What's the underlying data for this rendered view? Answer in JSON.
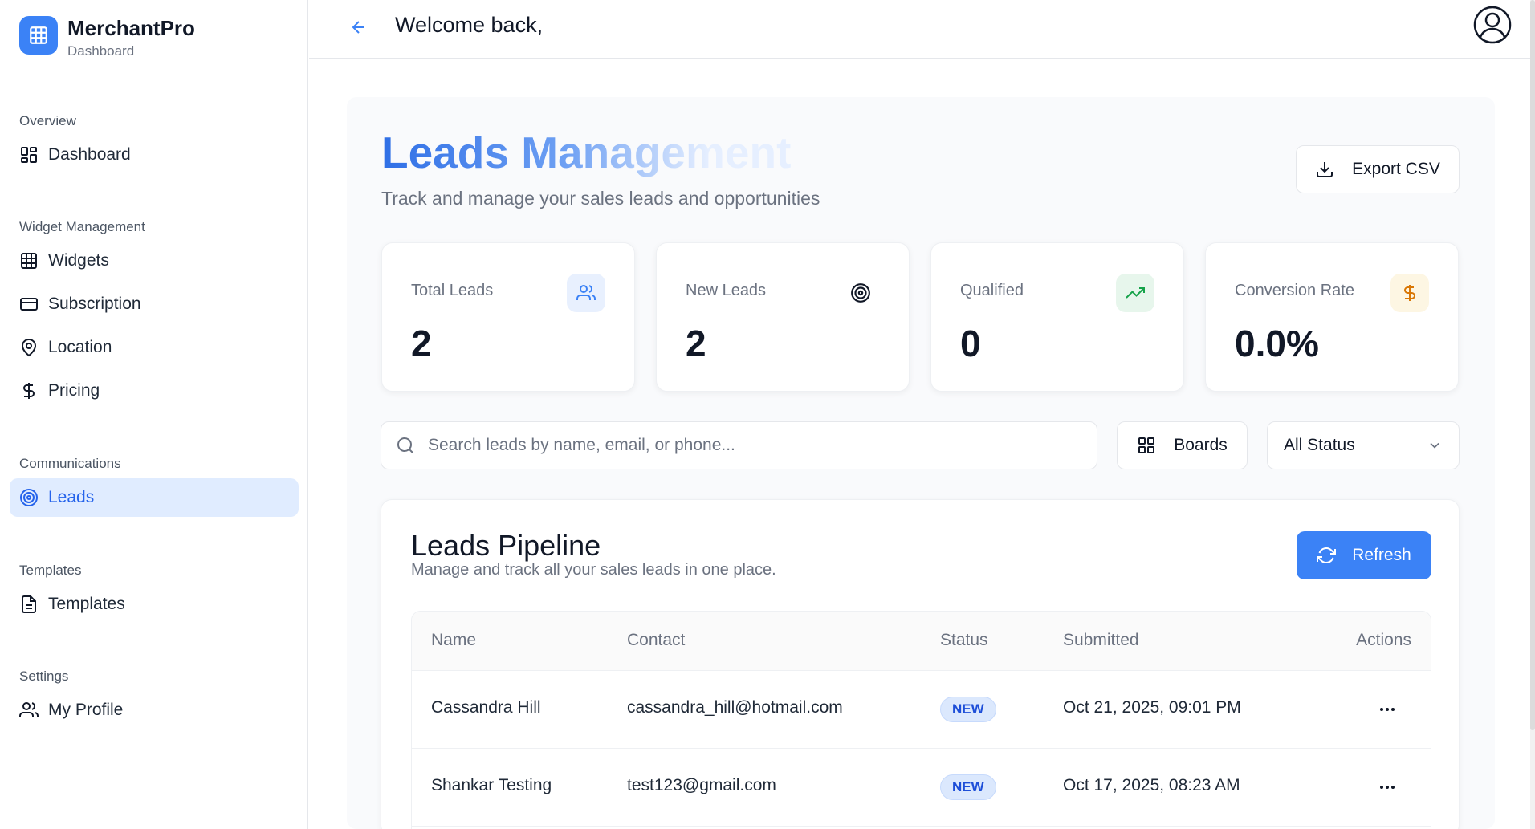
{
  "brand": {
    "name": "MerchantPro",
    "subtitle": "Dashboard"
  },
  "sidebar": {
    "sections": [
      {
        "heading": "Overview",
        "items": [
          {
            "label": "Dashboard",
            "icon": "dashboard-icon"
          }
        ]
      },
      {
        "heading": "Widget Management",
        "items": [
          {
            "label": "Widgets",
            "icon": "grid-icon"
          },
          {
            "label": "Subscription",
            "icon": "card-icon"
          },
          {
            "label": "Location",
            "icon": "map-pin-icon"
          },
          {
            "label": "Pricing",
            "icon": "dollar-icon"
          }
        ]
      },
      {
        "heading": "Communications",
        "items": [
          {
            "label": "Leads",
            "icon": "target-icon",
            "active": true
          }
        ]
      },
      {
        "heading": "Templates",
        "items": [
          {
            "label": "Templates",
            "icon": "document-icon"
          }
        ]
      },
      {
        "heading": "Settings",
        "items": [
          {
            "label": "My Profile",
            "icon": "users-icon"
          }
        ]
      }
    ]
  },
  "header": {
    "welcome": "Welcome back,"
  },
  "page": {
    "title": "Leads Management",
    "subtitle": "Track and manage your sales leads and opportunities",
    "export_label": "Export CSV"
  },
  "stats": [
    {
      "label": "Total Leads",
      "value": "2",
      "icon": "users-icon",
      "icon_color": "#3b82f6",
      "icon_bg": "#e8f0fe"
    },
    {
      "label": "New Leads",
      "value": "2",
      "icon": "target-icon",
      "icon_color": "#111827",
      "icon_bg": "#ffffff"
    },
    {
      "label": "Qualified",
      "value": "0",
      "icon": "trending-up-icon",
      "icon_color": "#16a34a",
      "icon_bg": "#e7f6ec"
    },
    {
      "label": "Conversion Rate",
      "value": "0.0%",
      "icon": "dollar-icon",
      "icon_color": "#d97706",
      "icon_bg": "#fdf6e3"
    }
  ],
  "filters": {
    "search_placeholder": "Search leads by name, email, or phone...",
    "boards_label": "Boards",
    "status_selected": "All Status"
  },
  "pipeline": {
    "title": "Leads Pipeline",
    "subtitle": "Manage and track all your sales leads in one place.",
    "refresh_label": "Refresh",
    "columns": [
      "Name",
      "Contact",
      "Status",
      "Submitted",
      "Actions"
    ],
    "rows": [
      {
        "name": "Cassandra Hill",
        "contact": "cassandra_hill@hotmail.com",
        "status": "NEW",
        "submitted": "Oct 21, 2025, 09:01 PM"
      },
      {
        "name": "Shankar Testing",
        "contact": "test123@gmail.com",
        "status": "NEW",
        "submitted": "Oct 17, 2025, 08:23 AM"
      }
    ]
  },
  "colors": {
    "accent": "#3b82f6",
    "active_bg": "#e0ecff",
    "badge_bg": "#dbe8fd",
    "badge_text": "#1d4ed8"
  }
}
